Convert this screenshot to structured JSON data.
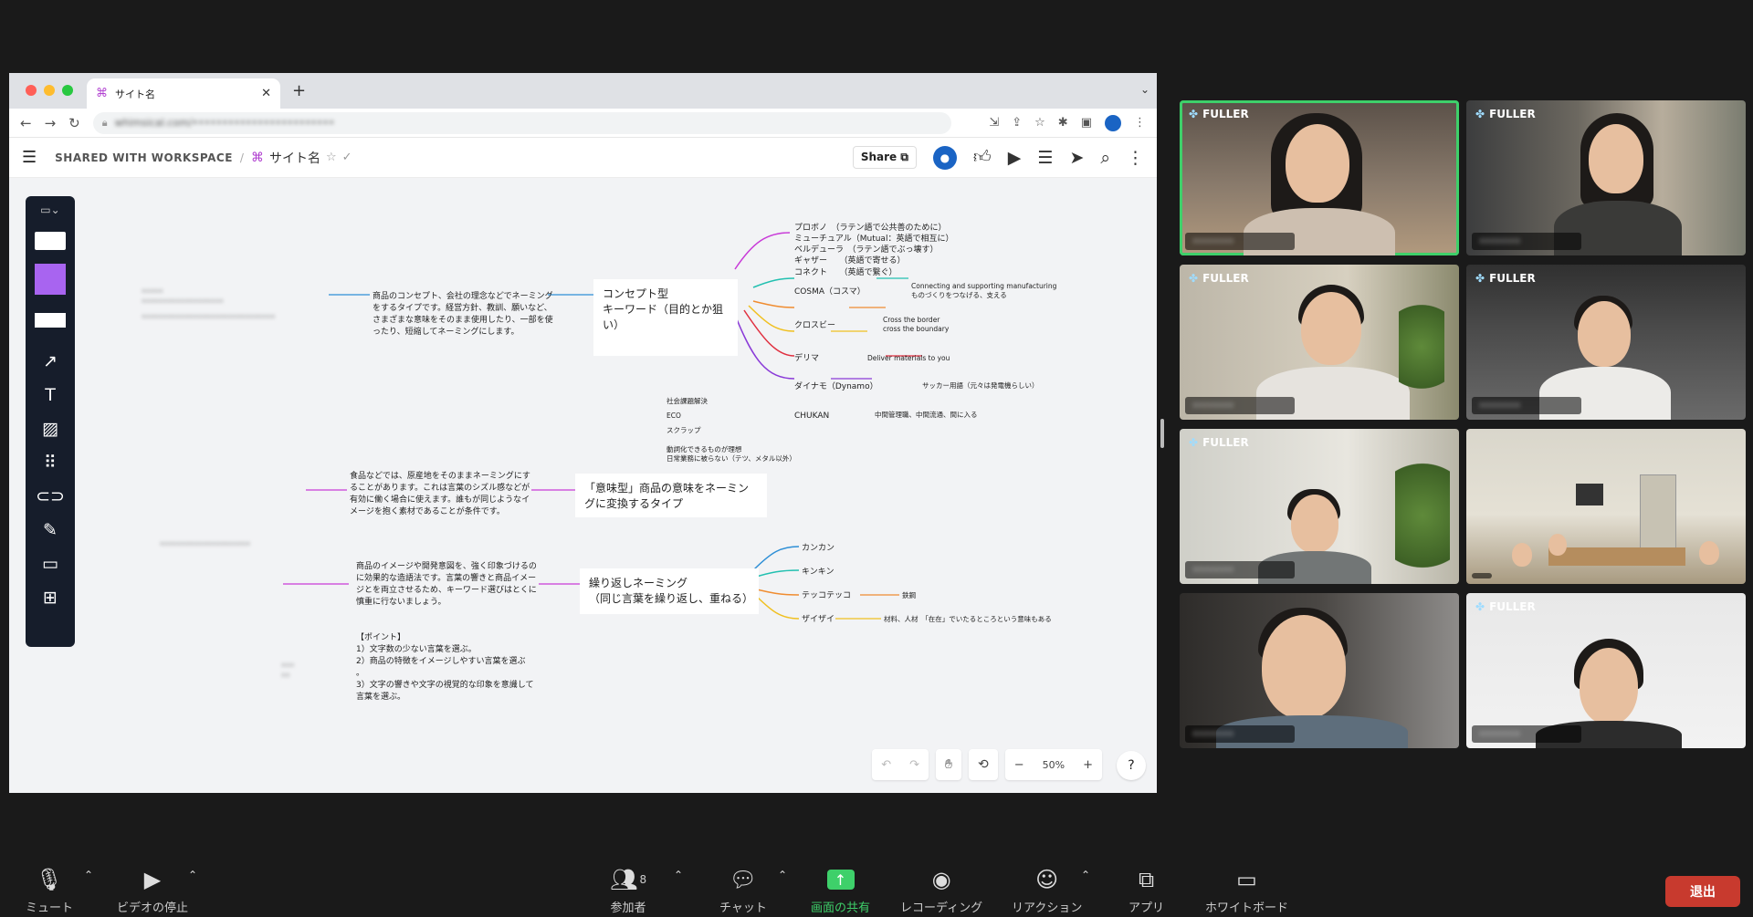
{
  "browser": {
    "tab_title": "サイト名",
    "new_tab": "+",
    "url_blurred": "whimsical.com/••••••••••••••••••••••••"
  },
  "app": {
    "breadcrumb": "SHARED WITH WORKSPACE",
    "separator": "/",
    "board_title": "サイト名",
    "share_label": "Share"
  },
  "mindmap": {
    "concept": {
      "description": "商品のコンセプト、会社の理念などでネーミングをするタイプです。経営方針、教訓、願いなど、さまざまな意味をそのまま使用したり、一部を使ったり、短縮してネーミングにします。",
      "card": "コンセプト型\nキーワード（目的とか狙い）",
      "branches": [
        {
          "label": "プロボノ　（ラテン語で公共善のために）\nミューチュアル（Mutual：英語で相互に）\nベルデューラ　（ラテン語でぶっ壊す）\nギャザー　　（英語で寄せる）\nコネクト　　（英語で繋ぐ）",
          "note": ""
        },
        {
          "label": "COSMA（コスマ）",
          "note": "Connecting and supporting manufacturing\nものづくりをつなげる、支える"
        },
        {
          "label": "クロスビー",
          "note": "Cross the border\ncross the boundary"
        },
        {
          "label": "デリマ",
          "note": "Deliver materials to you"
        },
        {
          "label": "ダイナモ（Dynamo）",
          "note": "サッカー用語（元々は発電機らしい）"
        },
        {
          "label": "CHUKAN",
          "note": "中間管理職、中間流通、間に入る"
        }
      ],
      "free_notes": [
        "社会課題解決",
        "ECO",
        "スクラップ",
        "動詞化できるものが理想\n日常業務に被らない（テツ、メタル以外）"
      ]
    },
    "meaning": {
      "description": "食品などでは、原産地をそのままネーミングにすることがあります。これは言葉のシズル感などが有効に働く場合に使えます。誰もが同じようなイメージを抱く素材であることが条件です。",
      "card": "「意味型」商品の意味をネーミングに変換するタイプ"
    },
    "repeat": {
      "description": "商品のイメージや開発意図を、強く印象づけるのに効果的な造語法です。言葉の響きと商品イメージとを両立させるため、キーワード選びはとくに慎重に行ないましょう。",
      "points": "【ポイント】\n1）文字数の少ない言葉を選ぶ。\n2）商品の特徴をイメージしやすい言葉を選ぶ\n。\n3）文字の響きや文字の視覚的な印象を意識して言葉を選ぶ。",
      "card": "繰り返しネーミング\n（同じ言葉を繰り返し、重ねる）",
      "branches": [
        {
          "label": "カンカン",
          "note": ""
        },
        {
          "label": "キンキン",
          "note": ""
        },
        {
          "label": "テッコテッコ",
          "note": "鉄鋼"
        },
        {
          "label": "ザイザイ",
          "note": "材料、人材　「在在」でいたるところという意味もある"
        }
      ]
    }
  },
  "zoom_level": "50%",
  "video_tiles": [
    {
      "brand": "FULLER",
      "name": "•••••••",
      "active": true
    },
    {
      "brand": "FULLER",
      "name": "•••••••",
      "active": false
    },
    {
      "brand": "FULLER",
      "name": "•••••••",
      "active": false
    },
    {
      "brand": "FULLER",
      "name": "•••••••",
      "active": false
    },
    {
      "brand": "FULLER",
      "name": "•••••••",
      "active": false
    },
    {
      "brand": "",
      "name": "",
      "active": false
    },
    {
      "brand": "",
      "name": "•••••••",
      "active": false
    },
    {
      "brand": "FULLER",
      "name": "•••••••",
      "active": false
    }
  ],
  "controls": {
    "mute": "ミュート",
    "video": "ビデオの停止",
    "participants": "参加者",
    "participants_count": "8",
    "chat": "チャット",
    "share": "画面の共有",
    "record": "レコーディング",
    "reaction": "リアクション",
    "apps": "アプリ",
    "whiteboard": "ホワイトボード",
    "leave": "退出"
  },
  "colors": {
    "share_green": "#3ed06a",
    "leave_red": "#c83a2e",
    "active_speaker": "#3ed06a",
    "whimsical_purple": "#b03fd0"
  }
}
